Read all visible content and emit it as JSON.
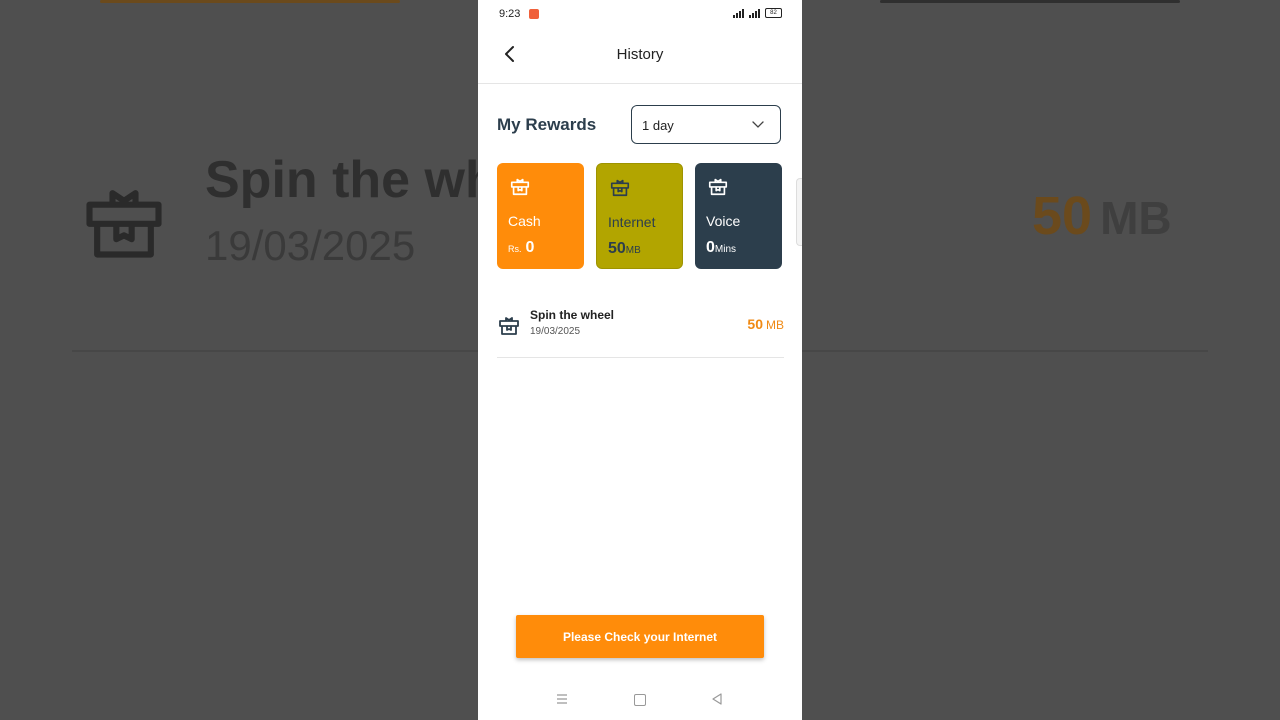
{
  "background": {
    "title": "Spin the wh",
    "date": "19/03/2025",
    "amount": "50",
    "unit": "MB"
  },
  "status_bar": {
    "time": "9:23",
    "battery": "82"
  },
  "header": {
    "title": "History",
    "back_icon": "chevron-left-icon"
  },
  "rewards": {
    "title": "My Rewards",
    "period": {
      "selected": "1 day",
      "icon": "chevron-down-icon"
    },
    "cards": [
      {
        "label": "Cash",
        "prefix": "Rs.",
        "value": "0",
        "unit": "",
        "color": "#ff8c0a",
        "icon": "gift-icon"
      },
      {
        "label": "Internet",
        "prefix": "",
        "value": "50",
        "unit": "MB",
        "color": "#b2a500",
        "icon": "gift-icon"
      },
      {
        "label": "Voice",
        "prefix": "",
        "value": "0",
        "unit": "Mins",
        "color": "#2c3e4c",
        "icon": "gift-icon"
      }
    ]
  },
  "history": [
    {
      "title": "Spin the wheel",
      "date": "19/03/2025",
      "amount": "50",
      "unit": "MB",
      "icon": "gift-icon"
    }
  ],
  "cta": {
    "label": "Please Check your Internet"
  },
  "colors": {
    "accent": "#ff8c0a",
    "internet": "#b2a500",
    "voice": "#2c3e4c",
    "amount": "#f08a14"
  }
}
